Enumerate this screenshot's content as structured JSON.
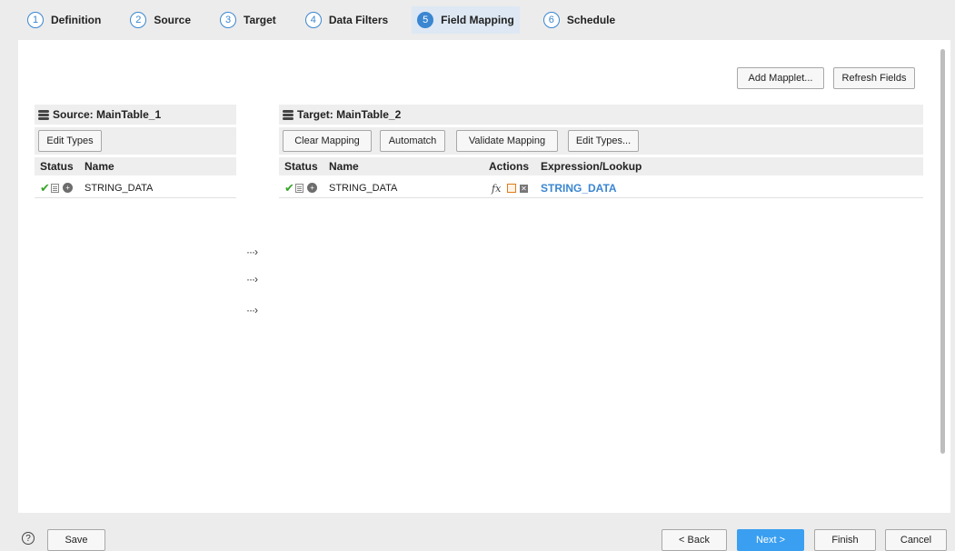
{
  "steps": [
    {
      "num": "1",
      "label": "Definition"
    },
    {
      "num": "2",
      "label": "Source"
    },
    {
      "num": "3",
      "label": "Target"
    },
    {
      "num": "4",
      "label": "Data Filters"
    },
    {
      "num": "5",
      "label": "Field Mapping"
    },
    {
      "num": "6",
      "label": "Schedule"
    }
  ],
  "active_step": "5",
  "top_buttons": {
    "add_mapplet": "Add Mapplet...",
    "refresh_fields": "Refresh Fields"
  },
  "source": {
    "title": "Source: MainTable_1",
    "edit_types": "Edit Types",
    "columns": {
      "status": "Status",
      "name": "Name"
    },
    "rows": [
      {
        "name": "STRING_DATA"
      }
    ]
  },
  "target": {
    "title": "Target: MainTable_2",
    "buttons": {
      "clear_mapping": "Clear Mapping",
      "automatch": "Automatch",
      "validate_mapping": "Validate Mapping",
      "edit_types": "Edit Types..."
    },
    "columns": {
      "status": "Status",
      "name": "Name",
      "actions": "Actions",
      "expression": "Expression/Lookup"
    },
    "rows": [
      {
        "name": "STRING_DATA",
        "fx": "fx",
        "expression": "STRING_DATA"
      }
    ]
  },
  "arrows": [
    "···›",
    "···›",
    "···›"
  ],
  "footer": {
    "help": "?",
    "save": "Save",
    "back": "< Back",
    "next": "Next >",
    "finish": "Finish",
    "cancel": "Cancel"
  },
  "colors": {
    "accent": "#3a86d1",
    "primary_button": "#3a9ff0",
    "check": "#38a52a",
    "edit_icon": "#e07b1a"
  }
}
